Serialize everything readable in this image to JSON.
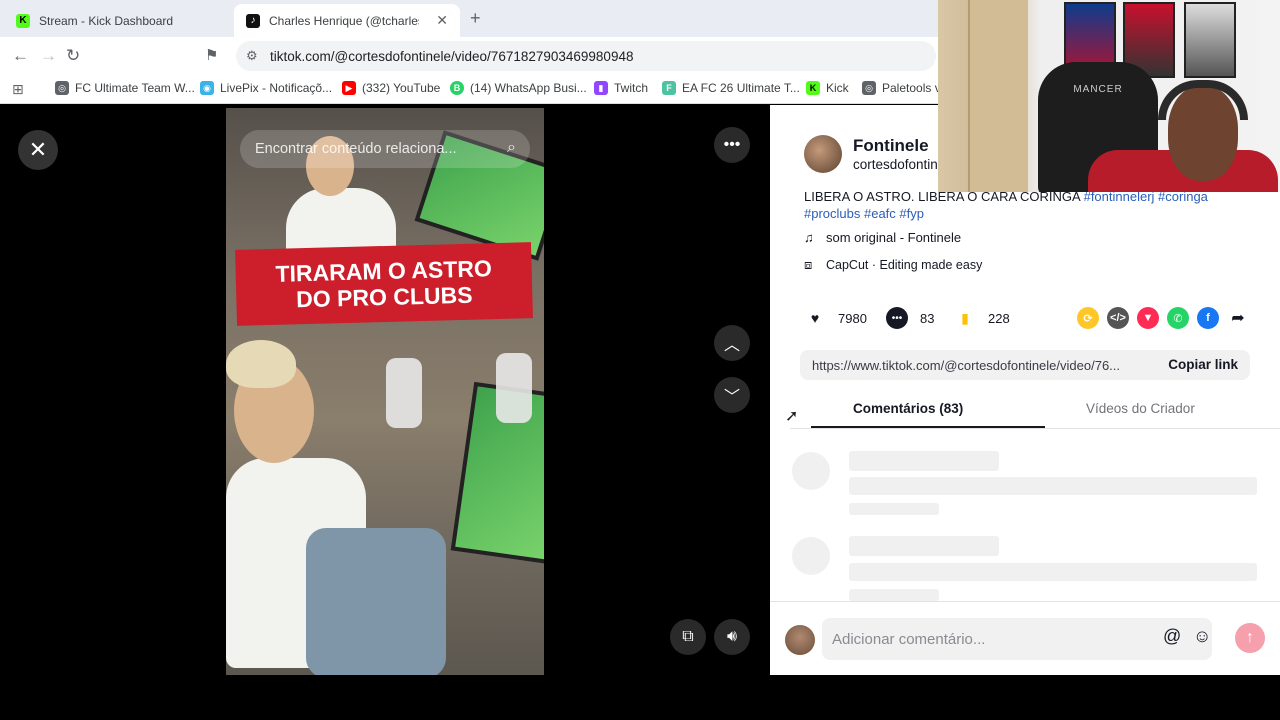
{
  "browser": {
    "tabs": [
      {
        "title": "Stream - Kick Dashboard",
        "favicon": "kick-logo"
      },
      {
        "title": "Charles Henrique (@tcharles",
        "favicon": "tiktok-logo"
      }
    ],
    "url": "tiktok.com/@cortesdofontinele/video/7671827903469980948",
    "bookmarks": [
      "FC Ultimate Team W...",
      "LivePix - Notificaçõ...",
      "(332) YouTube",
      "(14) WhatsApp Busi...",
      "Twitch",
      "EA FC 26 Ultimate T...",
      "Kick",
      "Paletools v"
    ]
  },
  "video": {
    "search_placeholder": "Encontrar conteúdo relaciona...",
    "overlay_line1": "TIRARAM O ASTRO",
    "overlay_line2": "DO PRO CLUBS"
  },
  "panel": {
    "author_name": "Fontinele",
    "author_handle": "cortesdofontinele",
    "caption_text": "LIBERA O ASTRO. LIBERA O CARA CORINGA ",
    "caption_tags_line1": "#fontinnelerj #coringa",
    "caption_tags_line2": "#proclubs #eafc #fyp",
    "sound": "som original - Fontinele",
    "capcut": "CapCut · Editing made easy",
    "likes": "7980",
    "comments": "83",
    "saves": "228",
    "link": "https://www.tiktok.com/@cortesdofontinele/video/76...",
    "copy_label": "Copiar link",
    "tab_comments": "Comentários (83)",
    "tab_videos": "Vídeos do Criador",
    "comment_placeholder": "Adicionar comentário..."
  },
  "webcam": {
    "chair_text": "MANCER"
  },
  "colors": {
    "tiktok_red": "#fe2c55",
    "hashtag_blue": "#2b5db9",
    "banner_red": "#cc1f2b"
  }
}
